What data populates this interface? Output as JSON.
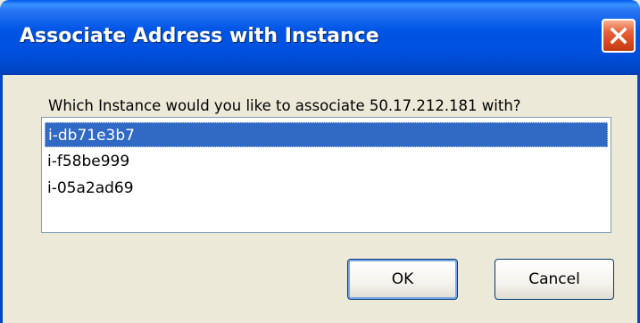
{
  "dialog": {
    "title": "Associate Address with Instance",
    "prompt": "Which Instance would you like to associate 50.17.212.181 with?",
    "instances": [
      {
        "id": "i-db71e3b7",
        "selected": true
      },
      {
        "id": "i-f58be999",
        "selected": false
      },
      {
        "id": "i-05a2ad69",
        "selected": false
      }
    ],
    "ok_label": "OK",
    "cancel_label": "Cancel"
  },
  "icons": {
    "close": "close-icon"
  },
  "colors": {
    "titlebar": "#0055e5",
    "selection": "#316ac5",
    "close_button": "#d94a1e",
    "dialog_face": "#ece9d8"
  }
}
